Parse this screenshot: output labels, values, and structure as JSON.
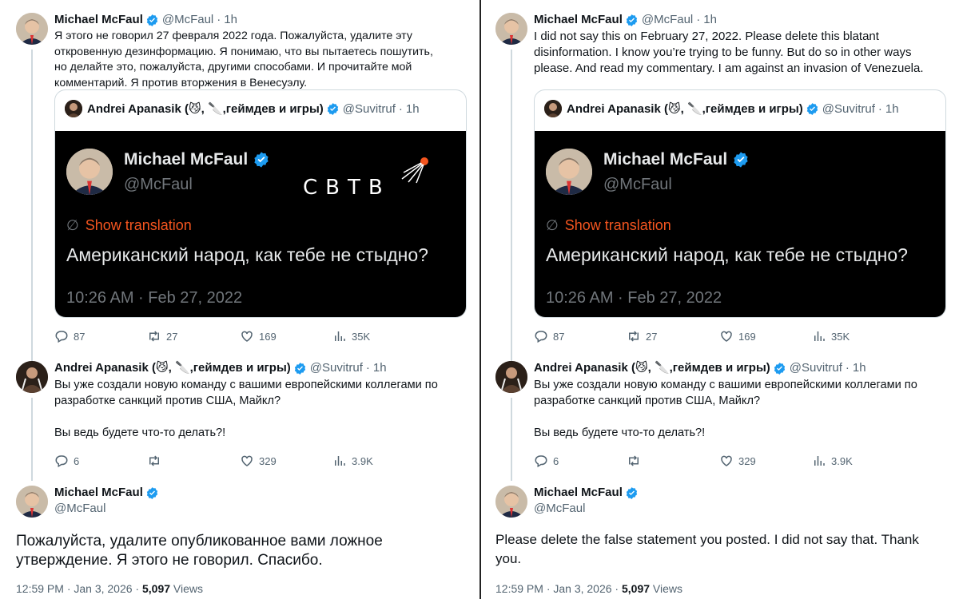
{
  "left": {
    "tweet1": {
      "name": "Michael McFaul",
      "handle": "@McFaul",
      "time": "1h",
      "text": "Я этого не говорил 27 февраля 2022 года. Пожалуйста, удалите эту\nоткровенную дезинформацию. Я понимаю, что вы пытаетесь пошутить,\nно делайте это, пожалуйста, другими способами. И прочитайте мой\nкомментарий. Я против вторжения в Венесуэлу.",
      "quote": {
        "name": "Andrei Apanasik (😼, 🔪,геймдев и игры)",
        "handle": "@Suvitruf",
        "time": "1h",
        "image": {
          "name": "Michael McFaul",
          "handle": "@McFaul",
          "show_translation": "Show translation",
          "text": "Американский народ, как тебе не стыдно?",
          "timestamp": "10:26 AM · Feb 27, 2022",
          "logo": "СВТВ"
        }
      },
      "stats": {
        "replies": "87",
        "retweets": "27",
        "likes": "169",
        "views": "35K"
      }
    },
    "tweet2": {
      "name": "Andrei Apanasik (😼, 🔪,геймдев и игры)",
      "handle": "@Suvitruf",
      "time": "1h",
      "text": "Вы уже создали новую команду с вашими европейскими коллегами по\nразработке санкций против США, Майкл?\n\nВы ведь будете что-то делать?!",
      "stats": {
        "replies": "6",
        "retweets": "",
        "likes": "329",
        "views": "3.9K"
      }
    },
    "main": {
      "name": "Michael McFaul",
      "handle": "@McFaul",
      "text": "Пожалуйста, удалите опубликованное вами ложное\nутверждение. Я этого не говорил. Спасибо.",
      "timestamp": "12:59 PM · Jan 3, 2026 · ",
      "views_count": "5,097",
      "views_label": " Views"
    }
  },
  "right": {
    "tweet1": {
      "name": "Michael McFaul",
      "handle": "@McFaul",
      "time": "1h",
      "text": "I did not say this on February 27, 2022. Please delete this blatant\ndisinformation. I know you’re trying to be funny. But do so in other ways\nplease. And read my commentary. I am against an invasion of Venezuela.",
      "quote": {
        "name": "Andrei Apanasik (😼, 🔪,геймдев и игры)",
        "handle": "@Suvitruf",
        "time": "1h",
        "image": {
          "name": "Michael McFaul",
          "handle": "@McFaul",
          "show_translation": "Show translation",
          "text": "Американский народ, как тебе не стыдно?",
          "timestamp": "10:26 AM · Feb 27, 2022"
        }
      },
      "stats": {
        "replies": "87",
        "retweets": "27",
        "likes": "169",
        "views": "35K"
      }
    },
    "tweet2": {
      "name": "Andrei Apanasik (😼, 🔪,геймдев и игры)",
      "handle": "@Suvitruf",
      "time": "1h",
      "text": "Вы уже создали новую команду с вашими европейскими коллегами по\nразработке санкций против США, Майкл?\n\nВы ведь будете что-то делать?!",
      "stats": {
        "replies": "6",
        "retweets": "",
        "likes": "329",
        "views": "3.9K"
      }
    },
    "main": {
      "name": "Michael McFaul",
      "handle": "@McFaul",
      "text": "Please delete the false statement you posted. I did not say that. Thank\nyou.",
      "timestamp": "12:59 PM · Jan 3, 2026 · ",
      "views_count": "5,097",
      "views_label": " Views"
    }
  },
  "colors": {
    "verified": "#1d9bf0",
    "translation": "#f4551f",
    "muted": "#536471"
  },
  "icons": [
    "reply-icon",
    "retweet-icon",
    "like-icon",
    "views-icon",
    "verified-icon",
    "translate-icon"
  ]
}
